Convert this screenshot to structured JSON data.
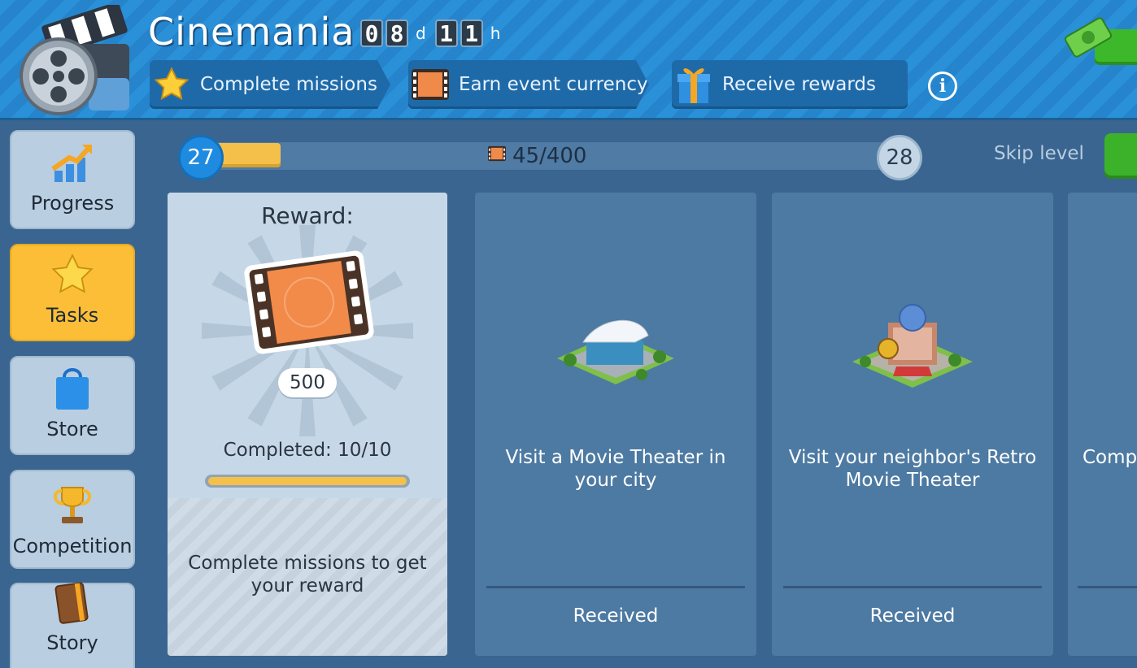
{
  "header": {
    "title": "Cinemania",
    "timer": {
      "days": [
        "0",
        "8"
      ],
      "days_unit": "d",
      "hours": [
        "1",
        "1"
      ],
      "hours_unit": "h"
    },
    "steps": [
      {
        "label": "Complete missions",
        "icon": "star-icon"
      },
      {
        "label": "Earn event currency",
        "icon": "film-frame-icon"
      },
      {
        "label": "Receive rewards",
        "icon": "gift-icon"
      }
    ],
    "info_icon": "i"
  },
  "sidebar": {
    "items": [
      {
        "label": "Progress",
        "icon": "progress-chart-icon",
        "active": false
      },
      {
        "label": "Tasks",
        "icon": "star-icon",
        "active": true
      },
      {
        "label": "Store",
        "icon": "shopping-bag-icon",
        "active": false
      },
      {
        "label": "Competition",
        "icon": "trophy-icon",
        "active": false
      },
      {
        "label": "Story",
        "icon": "book-icon",
        "active": false
      }
    ]
  },
  "level": {
    "current": "27",
    "next": "28",
    "progress_text": "45/400",
    "progress_fraction": 0.1125,
    "skip_label": "Skip level"
  },
  "reward": {
    "title": "Reward:",
    "amount": "500",
    "completed": "Completed: 10/10",
    "completed_fraction": 1.0,
    "note": "Complete missions to get your reward"
  },
  "tasks": [
    {
      "text": "Visit a Movie Theater in your city",
      "status": "Received",
      "icon": "movie-theater-building-icon"
    },
    {
      "text": "Visit your neighbor's Retro Movie Theater",
      "status": "Received",
      "icon": "retro-theater-building-icon"
    },
    {
      "text": "Comp",
      "status": "",
      "icon": ""
    }
  ],
  "colors": {
    "header_blue": "#2a90d8",
    "panel_blue": "#3a6590",
    "card_blue": "#4d7aa2",
    "active_yellow": "#fbbe36",
    "progress_yellow": "#f5c04a",
    "green": "#3cb22a"
  }
}
